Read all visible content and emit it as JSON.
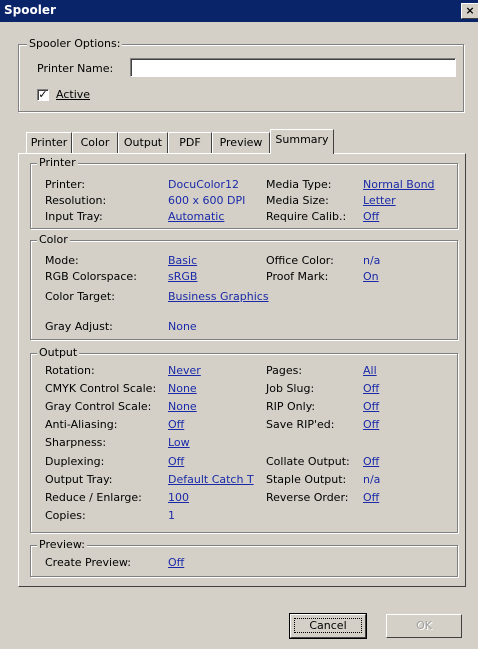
{
  "window": {
    "title": "Spooler",
    "close": "×"
  },
  "spooler_options": {
    "legend": "Spooler Options:",
    "printer_name_label": "Printer Name:",
    "printer_name_value": "",
    "active_label": "Active",
    "active_checked": "✓"
  },
  "tabs": [
    "Printer",
    "Color",
    "Output",
    "PDF",
    "Preview",
    "Summary"
  ],
  "printer": {
    "legend": "Printer",
    "printer_label": "Printer:",
    "printer_value": "DocuColor12",
    "resolution_label": "Resolution:",
    "resolution_value": "600 x 600 DPI",
    "input_tray_label": "Input Tray:",
    "input_tray_value": "Automatic",
    "media_type_label": "Media Type:",
    "media_type_value": "Normal Bond",
    "media_size_label": "Media Size:",
    "media_size_value": "Letter",
    "require_calib_label": "Require Calib.:",
    "require_calib_value": "Off"
  },
  "color": {
    "legend": "Color",
    "mode_label": "Mode:",
    "mode_value": "Basic",
    "rgb_label": "RGB Colorspace:",
    "rgb_value": "sRGB",
    "target_label": "Color Target:",
    "target_value": "Business Graphics",
    "gray_label": "Gray Adjust:",
    "gray_value": "None",
    "office_label": "Office Color:",
    "office_value": "n/a",
    "proof_label": "Proof Mark:",
    "proof_value": "On"
  },
  "output": {
    "legend": "Output",
    "rotation_label": "Rotation:",
    "rotation_value": "Never",
    "cmyk_label": "CMYK Control Scale:",
    "cmyk_value": "None",
    "gray_label": "Gray Control Scale:",
    "gray_value": "None",
    "aa_label": "Anti-Aliasing:",
    "aa_value": "Off",
    "sharp_label": "Sharpness:",
    "sharp_value": "Low",
    "duplex_label": "Duplexing:",
    "duplex_value": "Off",
    "tray_label": "Output Tray:",
    "tray_value": "Default Catch T",
    "reduce_label": "Reduce / Enlarge:",
    "reduce_value": "100",
    "copies_label": "Copies:",
    "copies_value": "1",
    "pages_label": "Pages:",
    "pages_value": "All",
    "slug_label": "Job Slug:",
    "slug_value": "Off",
    "rip_label": "RIP Only:",
    "rip_value": "Off",
    "save_label": "Save RIP'ed:",
    "save_value": "Off",
    "collate_label": "Collate Output:",
    "collate_value": "Off",
    "staple_label": "Staple Output:",
    "staple_value": "n/a",
    "reverse_label": "Reverse Order:",
    "reverse_value": "Off"
  },
  "preview": {
    "legend": "Preview:",
    "create_label": "Create Preview:",
    "create_value": "Off"
  },
  "buttons": {
    "cancel": "Cancel",
    "ok": "OK"
  }
}
